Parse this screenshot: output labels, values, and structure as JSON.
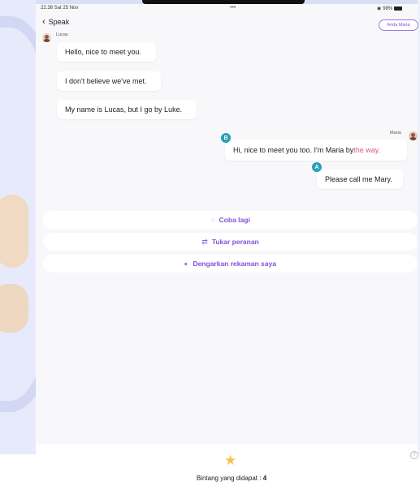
{
  "status_bar": {
    "time_date": "22.38  Sat 25 Nov",
    "dots": "•••",
    "right": "98%"
  },
  "header": {
    "back_label": "Speak",
    "role_label": "Anda Maria"
  },
  "conversation": {
    "lucas_name": "Lucas",
    "maria_name": "Maria",
    "lucas_messages": [
      "Hello, nice to meet you.",
      "I don't believe we've met.",
      "My name is Lucas, but I go by Luke."
    ],
    "maria_message_b_prefix": "Hi, nice to meet you too. I'm Maria by ",
    "maria_message_b_highlight": "the way.",
    "maria_message_a": "Please call me Mary.",
    "badge_b": "B",
    "badge_a": "A"
  },
  "actions": {
    "retry": "Coba lagi",
    "swap": "Tukar peranan",
    "listen": "Dengarkan rekaman saya"
  },
  "footer": {
    "stars_label": "Bintang yang didapat : ",
    "stars_count": "4",
    "help_glyph": "?"
  },
  "colors": {
    "accent": "#7e52d8",
    "badge": "#2a9fb8",
    "error_text": "#d45b82",
    "star": "#f3c34a"
  }
}
